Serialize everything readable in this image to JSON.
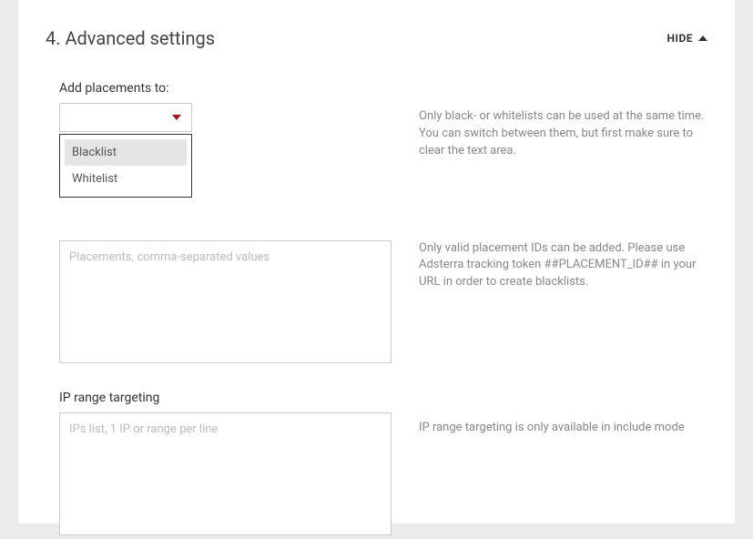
{
  "panel": {
    "title": "4. Advanced settings",
    "hide_label": "HIDE"
  },
  "placements": {
    "label": "Add placements to:",
    "select_value": "",
    "options": [
      "Blacklist",
      "Whitelist"
    ],
    "textarea_placeholder": "Placements, comma-separated values",
    "help_top": "Only black- or whitelists can be used at the same time. You can switch between them, but first make sure to clear the text area.",
    "help_textarea": "Only valid placement IDs can be added. Please use Adsterra tracking token ##PLACEMENT_ID## in your URL in order to create blacklists."
  },
  "ip": {
    "label": "IP range targeting",
    "textarea_placeholder": "IPs list, 1 IP or range per line",
    "help": "IP range targeting is only available in include mode"
  }
}
